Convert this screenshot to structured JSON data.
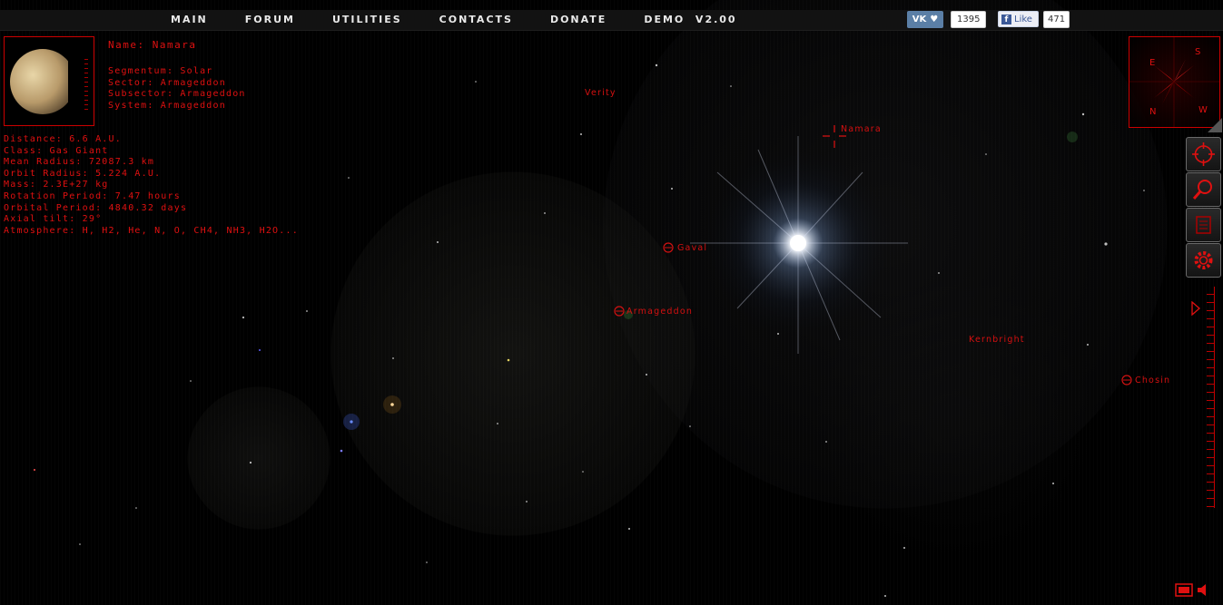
{
  "nav": {
    "items": [
      "Main",
      "Forum",
      "Utilities",
      "Contacts",
      "Donate",
      "Demo  v2.00"
    ]
  },
  "social": {
    "vk_label": "VK",
    "vk_count": "1395",
    "fb_label": "Like",
    "fb_count": "471"
  },
  "planet_info": {
    "name": "Name: Namara",
    "segmentum": "Segmentum: Solar",
    "sector": "Sector: Armageddon",
    "subsector": "Subsector: Armageddon",
    "system": "System: Armageddon",
    "distance": "Distance: 6.6 A.U.",
    "class": "Class: Gas Giant",
    "mean_radius": "Mean Radius: 72087.3 km",
    "orbit_radius": "Orbit Radius: 5.224 A.U.",
    "mass": "Mass: 2.3E+27 kg",
    "rotation_period": "Rotation Period: 7.47 hours",
    "orbital_period": "Orbital Period: 4840.32 days",
    "axial_tilt": "Axial tilt: 29°",
    "atmosphere": "Atmosphere: H, H2, He, N, O, CH4, NH3, H2O..."
  },
  "map_labels": {
    "verity": "Verity",
    "namara": "Namara",
    "gaval": "Gaval",
    "armageddon": "Armageddon",
    "kernbright": "Kernbright",
    "chosin": "Chosin"
  },
  "compass": {
    "n": "N",
    "s": "S",
    "e": "E",
    "w": "W"
  },
  "colors": {
    "accent": "#e01010",
    "background": "#000000",
    "nav_bg": "#121212"
  }
}
